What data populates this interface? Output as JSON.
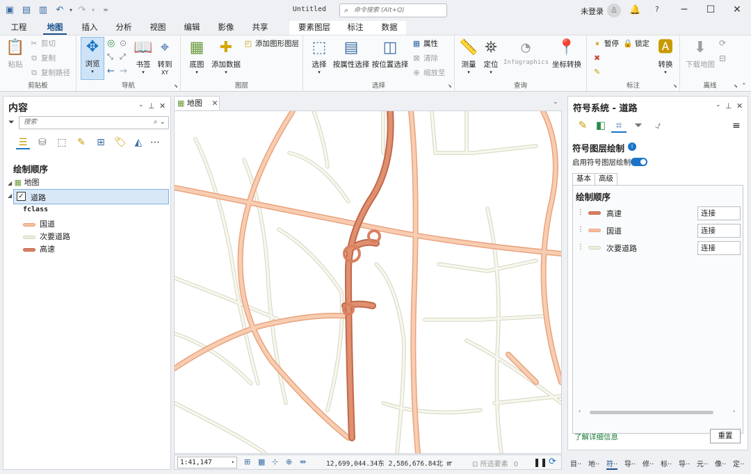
{
  "app": {
    "title": "Untitled",
    "search_placeholder": "命令搜索 (Alt+Q)",
    "user": "未登录"
  },
  "tabs": [
    "工程",
    "地图",
    "插入",
    "分析",
    "视图",
    "编辑",
    "影像",
    "共享"
  ],
  "context_tabs": [
    "要素图层",
    "标注",
    "数据"
  ],
  "ribbon": {
    "clipboard": {
      "label": "剪贴板",
      "paste": "粘贴",
      "cut": "剪切",
      "copy": "复制",
      "copy_path": "复制路径"
    },
    "navigate": {
      "label": "导航",
      "explore": "浏览",
      "bookmarks": "书签",
      "goto": "转到",
      "goto_sub": "XY"
    },
    "layer": {
      "label": "图层",
      "basemap": "底图",
      "add_data": "添加数据",
      "add_graphics": "添加图形图层"
    },
    "selection": {
      "label": "选择",
      "select": "选择",
      "by_attr": "按属性选择",
      "by_loc": "按位置选择",
      "attributes": "属性",
      "clear": "清除",
      "zoom_to": "缩放至"
    },
    "inquiry": {
      "label": "查询",
      "measure": "测量",
      "locate": "定位",
      "infographics": "Infographics",
      "convert_coord": "坐标转换"
    },
    "labeling": {
      "label": "标注",
      "pause": "暂停",
      "lock": "锁定",
      "convert": "转换"
    },
    "offline": {
      "label": "离线",
      "download_map": "下载地图"
    }
  },
  "contents": {
    "title": "内容",
    "search_placeholder": "搜索",
    "draw_order": "绘制顺序",
    "map_name": "地图",
    "layer_name": "道路",
    "field": "fclass",
    "legend": [
      {
        "label": "国道",
        "color": "#f5bfa0"
      },
      {
        "label": "次要道路",
        "color": "#eeeedd"
      },
      {
        "label": "高速",
        "color": "#d98060"
      }
    ]
  },
  "map": {
    "tab_label": "地图",
    "scale": "1:41,147",
    "coords": "12,699,044.34东 2,586,676.84北 m",
    "selected_label": "所选要素",
    "selected_count": "0"
  },
  "symbology": {
    "title": "符号系统 - 道路",
    "symbol_layer_drawing": "符号图层绘制",
    "enable_label": "启用符号图层绘制",
    "enabled": true,
    "tabs": [
      "基本",
      "高级"
    ],
    "draw_order": "绘制顺序",
    "rows": [
      {
        "label": "高速",
        "color": "#d98060",
        "value": "连接"
      },
      {
        "label": "国道",
        "color": "#f5bfa0",
        "value": "连接"
      },
      {
        "label": "次要道路",
        "color": "#eeeedd",
        "value": "连接"
      }
    ],
    "learn_more": "了解详细信息",
    "reset": "重置"
  },
  "bottom_tabs": [
    "目··",
    "地··",
    "符··",
    "导··",
    "修··",
    "标··",
    "导··",
    "元··",
    "像··",
    "定··"
  ],
  "colors": {
    "accent": "#1a73c9",
    "highway": "#d98060",
    "national": "#f5bfa0",
    "minor": "#eeeedd"
  }
}
